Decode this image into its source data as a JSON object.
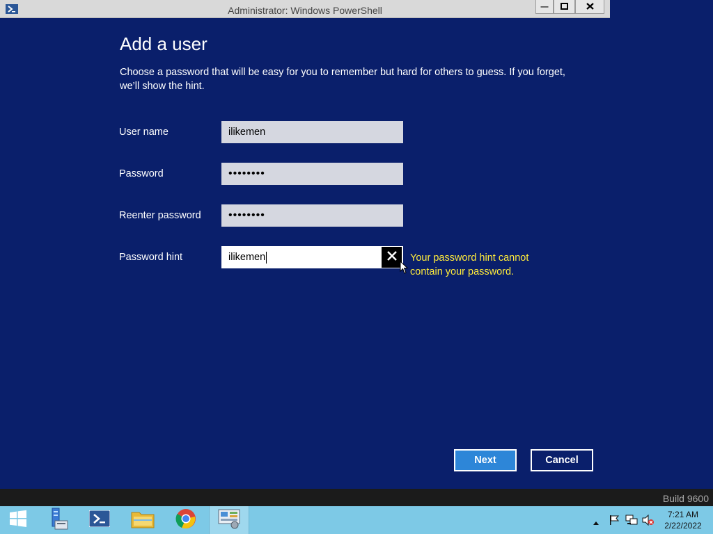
{
  "window": {
    "title": "Administrator: Windows PowerShell",
    "minimize_glyph": "—",
    "maximize_glyph": "▣",
    "close_glyph": "✕"
  },
  "dialog": {
    "heading": "Add a user",
    "description": "Choose a password that will be easy for you to remember but hard for others to guess. If you forget, we’ll show the hint.",
    "fields": {
      "username": {
        "label": "User name",
        "value": "ilikemen"
      },
      "password": {
        "label": "Password",
        "value": "••••••••"
      },
      "reenter": {
        "label": "Reenter password",
        "value": "••••••••"
      },
      "hint": {
        "label": "Password hint",
        "value": "ilikemen"
      }
    },
    "error": "Your password hint cannot contain your password.",
    "buttons": {
      "next": "Next",
      "cancel": "Cancel"
    }
  },
  "build": "Build 9600",
  "taskbar": {
    "apps": [
      "start",
      "server-manager",
      "powershell",
      "file-explorer",
      "chrome",
      "control-panel"
    ],
    "clock": {
      "time": "7:21 AM",
      "date": "2/22/2022"
    }
  },
  "colors": {
    "background": "#0a1f6b",
    "accent": "#2d86d8",
    "error": "#ffeb3b",
    "taskbar": "#7dc9e6"
  }
}
